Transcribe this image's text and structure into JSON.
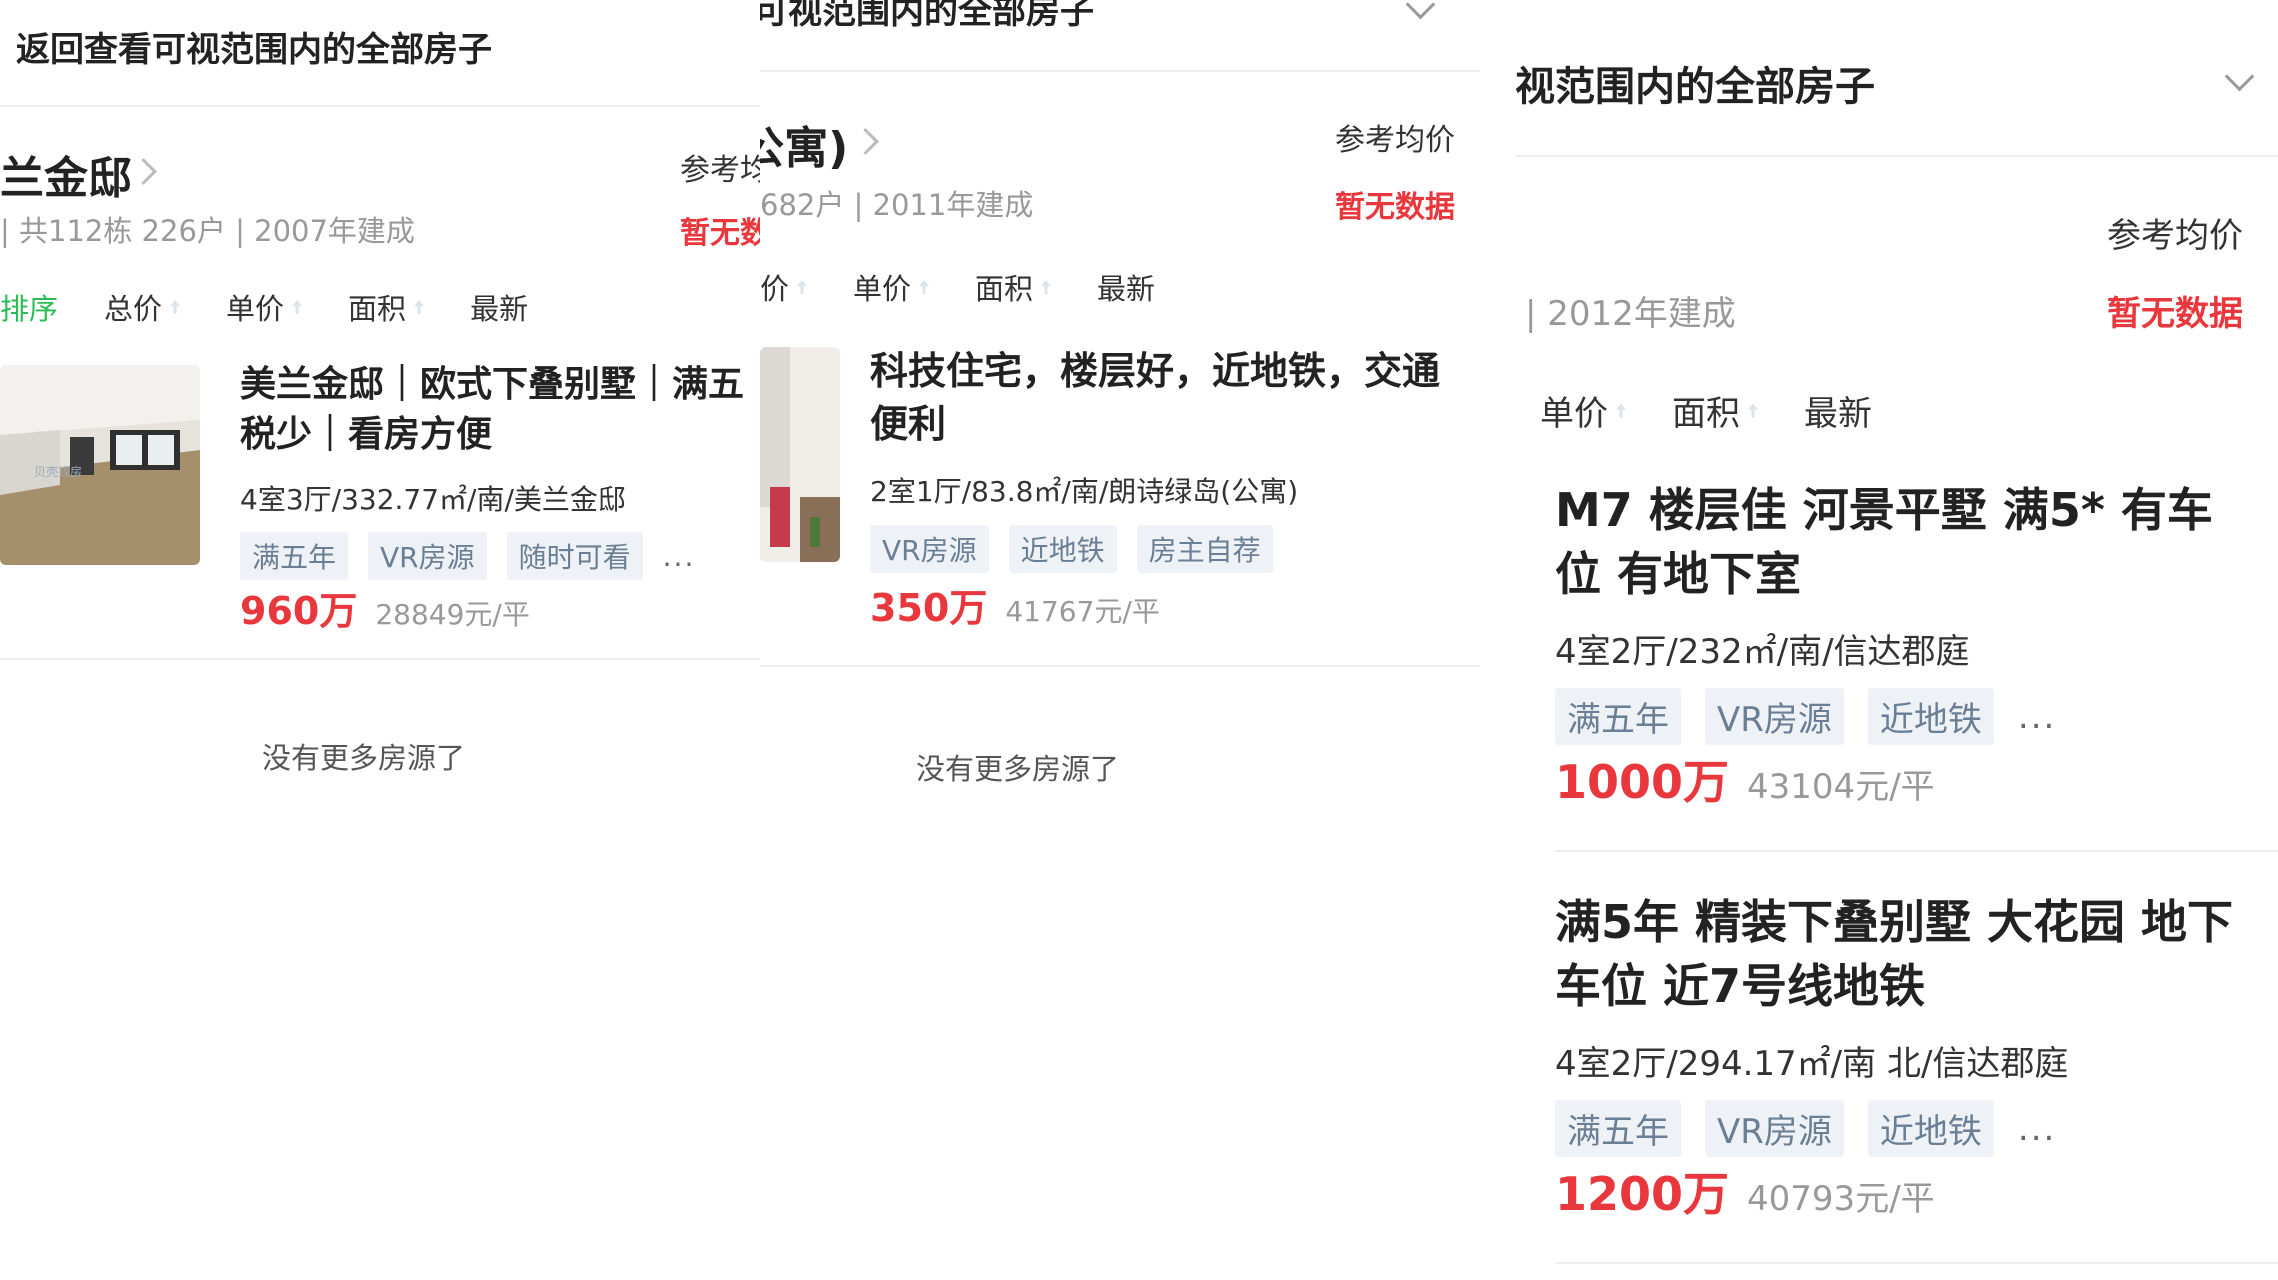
{
  "panels": [
    {
      "banner": "返回查看可视范围内的全部房子",
      "community": {
        "title": "兰金邸",
        "meta": "| 共112栋 226户 | 2007年建成",
        "ref_label": "参考均价",
        "ref_value": "暂无数据"
      },
      "sort": [
        "排序",
        "总价",
        "单价",
        "面积",
        "最新"
      ],
      "listings": [
        {
          "title": "美兰金邸｜欧式下叠别墅｜满五税少｜看房方便",
          "info": "4室3厅/332.77㎡/南/美兰金邸",
          "tags": [
            "满五年",
            "VR房源",
            "随时可看"
          ],
          "more": "...",
          "price": "960万",
          "unit_price": "28849元/平",
          "thumb_watermark": "贝壳找房"
        }
      ],
      "end_note": "没有更多房源了"
    },
    {
      "banner": "看可视范围内的全部房子",
      "community": {
        "title": "(公寓)",
        "meta": "682户 | 2011年建成",
        "ref_label": "参考均价",
        "ref_value": "暂无数据"
      },
      "sort": [
        "价",
        "单价",
        "面积",
        "最新"
      ],
      "listings": [
        {
          "title": "科技住宅，楼层好，近地铁，交通便利",
          "info": "2室1厅/83.8㎡/南/朗诗绿岛(公寓)",
          "tags": [
            "VR房源",
            "近地铁",
            "房主自荐"
          ],
          "price": "350万",
          "unit_price": "41767元/平"
        }
      ],
      "end_note": "没有更多房源了"
    },
    {
      "banner": "视范围内的全部房子",
      "community": {
        "meta": "| 2012年建成",
        "ref_label": "参考均价",
        "ref_value": "暂无数据"
      },
      "sort": [
        "单价",
        "面积",
        "最新"
      ],
      "listings": [
        {
          "title": "M7 楼层佳 河景平墅 满5* 有车位 有地下室",
          "info": "4室2厅/232㎡/南/信达郡庭",
          "tags": [
            "满五年",
            "VR房源",
            "近地铁"
          ],
          "more": "...",
          "price": "1000万",
          "unit_price": "43104元/平"
        },
        {
          "title": "满5年 精装下叠别墅 大花园 地下车位 近7号线地铁",
          "info": "4室2厅/294.17㎡/南 北/信达郡庭",
          "tags": [
            "满五年",
            "VR房源",
            "近地铁"
          ],
          "more": "...",
          "price": "1200万",
          "unit_price": "40793元/平"
        }
      ]
    }
  ],
  "colors": {
    "price": "#e8383d",
    "active_sort": "#2dbb55",
    "tag_bg": "#eef2f6",
    "tag_text": "#6a7f95"
  }
}
